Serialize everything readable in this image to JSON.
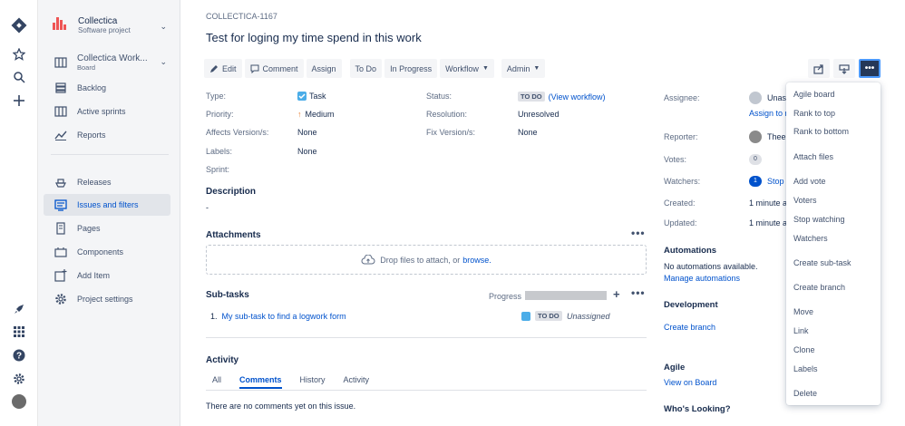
{
  "project": {
    "name": "Collectica",
    "type": "Software project"
  },
  "board": {
    "name": "Collectica Work...",
    "type": "Board"
  },
  "sidebar": {
    "items": [
      {
        "label": "Backlog"
      },
      {
        "label": "Active sprints"
      },
      {
        "label": "Reports"
      },
      {
        "label": "Releases"
      },
      {
        "label": "Issues and filters"
      },
      {
        "label": "Pages"
      },
      {
        "label": "Components"
      },
      {
        "label": "Add Item"
      },
      {
        "label": "Project settings"
      }
    ]
  },
  "issue": {
    "key": "COLLECTICA-1167",
    "title": "Test for loging my time spend in this work"
  },
  "toolbar": {
    "edit": "Edit",
    "comment": "Comment",
    "assign": "Assign",
    "todo": "To Do",
    "inprogress": "In Progress",
    "workflow": "Workflow",
    "admin": "Admin",
    "more": "•••"
  },
  "details": {
    "type_label": "Type:",
    "type_value": "Task",
    "priority_label": "Priority:",
    "priority_value": "Medium",
    "affects_label": "Affects Version/s:",
    "affects_value": "None",
    "labels_label": "Labels:",
    "labels_value": "None",
    "sprint_label": "Sprint:",
    "status_label": "Status:",
    "status_value": "TO DO",
    "view_workflow": "(View workflow)",
    "resolution_label": "Resolution:",
    "resolution_value": "Unresolved",
    "fix_label": "Fix Version/s:",
    "fix_value": "None"
  },
  "description": {
    "title": "Description",
    "value": "-"
  },
  "attachments": {
    "title": "Attachments",
    "drop_text": "Drop files to attach, or",
    "browse": "browse."
  },
  "subtasks": {
    "title": "Sub-tasks",
    "progress_label": "Progress",
    "items": [
      {
        "num": "1.",
        "summary": "My sub-task to find a logwork form",
        "status": "TO DO",
        "assignee": "Unassigned"
      }
    ]
  },
  "activity": {
    "title": "Activity",
    "tabs": [
      "All",
      "Comments",
      "History",
      "Activity"
    ],
    "empty": "There are no comments yet on this issue."
  },
  "people": {
    "assignee_label": "Assignee:",
    "assignee_value": "Unass",
    "assign_to_me": "Assign to m",
    "reporter_label": "Reporter:",
    "reporter_value": "Thee",
    "votes_label": "Votes:",
    "votes_count": "0",
    "watchers_label": "Watchers:",
    "watchers_count": "1",
    "stop_link": "Stop",
    "created_label": "Created:",
    "created_value": "1 minute a",
    "updated_label": "Updated:",
    "updated_value": "1 minute a"
  },
  "automations": {
    "title": "Automations",
    "text": "No automations available.",
    "manage": "Manage automations"
  },
  "development": {
    "title": "Development",
    "create_branch": "Create branch"
  },
  "agile": {
    "title": "Agile",
    "view_board": "View on Board"
  },
  "who_looking": {
    "title": "Who's Looking?"
  },
  "menu": {
    "items": [
      "Agile board",
      "Rank to top",
      "Rank to bottom",
      "Attach files",
      "Add vote",
      "Voters",
      "Stop watching",
      "Watchers",
      "Create sub-task",
      "Create branch",
      "Move",
      "Link",
      "Clone",
      "Labels",
      "Delete"
    ]
  },
  "colors": {
    "accent": "#0052cc",
    "more_button": "#253858"
  }
}
